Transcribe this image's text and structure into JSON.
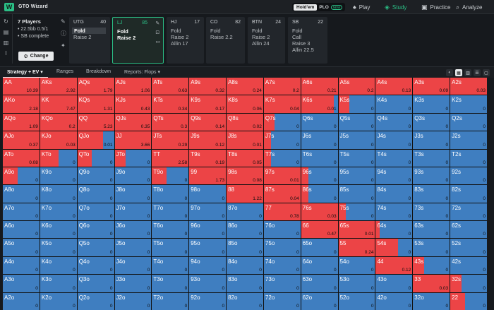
{
  "app": {
    "logo_letter": "W",
    "brand": "GTO Wizard"
  },
  "game_toggle": {
    "holdem": "Hold'em",
    "plo": "PLO",
    "plo_badge": "NEW"
  },
  "nav": [
    {
      "label": "Play",
      "icon": "spade"
    },
    {
      "label": "Study",
      "icon": "layers",
      "active": true
    },
    {
      "label": "Practice",
      "icon": "gamepad"
    },
    {
      "label": "Analyze",
      "icon": "search"
    }
  ],
  "info": {
    "players": "7 Players",
    "stack": "• 22.5bb 0.5/1",
    "status": "• SB complete",
    "change_label": "Change"
  },
  "positions": [
    {
      "name": "UTG",
      "stack": "40",
      "actions": [
        "Fold",
        "Raise 2"
      ],
      "selected": 0
    },
    {
      "name": "LJ",
      "stack": "85",
      "actions": [
        "Fold",
        "Raise 2"
      ],
      "selected": 1,
      "active": true
    },
    {
      "name": "HJ",
      "stack": "17",
      "actions": [
        "Fold",
        "Raise 2",
        "Allin 17"
      ]
    },
    {
      "name": "CO",
      "stack": "82",
      "actions": [
        "Fold",
        "Raise 2.2"
      ]
    },
    {
      "name": "BTN",
      "stack": "24",
      "actions": [
        "Fold",
        "Raise 2",
        "Allin 24"
      ]
    },
    {
      "name": "SB",
      "stack": "22",
      "actions": [
        "Fold",
        "Call",
        "Raise 3",
        "Allin 22.5"
      ]
    }
  ],
  "tabs": {
    "strategy": "Strategy + EV",
    "ranges": "Ranges",
    "breakdown": "Breakdown",
    "reports": "Reports: Flops"
  },
  "colors": {
    "raise": "#ec4446",
    "fold": "#3f7ec0",
    "accent": "#2bbf86"
  },
  "grid": {
    "ranks": [
      "A",
      "K",
      "Q",
      "J",
      "T",
      "9",
      "8",
      "7",
      "6",
      "5",
      "4",
      "3",
      "2"
    ],
    "raise_freq": [
      [
        1,
        1,
        1,
        1,
        1,
        1,
        1,
        1,
        1,
        1,
        1,
        1,
        1
      ],
      [
        1,
        1,
        1,
        1,
        1,
        1,
        1,
        1,
        0.9,
        0.3,
        0,
        0,
        0
      ],
      [
        1,
        1,
        1,
        1,
        1,
        1,
        1,
        0.3,
        0,
        0,
        0,
        0,
        0
      ],
      [
        1,
        1,
        0.7,
        1,
        1,
        1,
        1,
        0.2,
        0,
        0,
        0,
        0,
        0
      ],
      [
        1,
        0.5,
        0.4,
        0.3,
        1,
        1,
        1,
        0.2,
        0,
        0,
        0,
        0,
        0
      ],
      [
        0.4,
        0,
        0,
        0,
        0.4,
        1,
        1,
        1,
        0.2,
        0,
        0,
        0,
        0
      ],
      [
        0,
        0,
        0,
        0,
        0,
        0,
        1,
        1,
        0.2,
        0,
        0,
        0,
        0
      ],
      [
        0,
        0,
        0,
        0,
        0,
        0,
        0,
        1,
        1,
        0.2,
        0,
        0,
        0
      ],
      [
        0,
        0,
        0,
        0,
        0,
        0,
        0,
        0,
        1,
        1,
        0.1,
        0,
        0
      ],
      [
        0,
        0,
        0,
        0,
        0,
        0,
        0,
        0,
        0,
        1,
        0.6,
        0,
        0
      ],
      [
        0,
        0,
        0,
        0,
        0,
        0,
        0,
        0,
        0,
        0,
        1,
        0.3,
        0
      ],
      [
        0,
        0,
        0,
        0,
        0,
        0,
        0,
        0,
        0,
        0,
        0,
        1,
        0.3
      ],
      [
        0,
        0,
        0,
        0,
        0,
        0,
        0,
        0,
        0,
        0,
        0,
        0,
        0.4
      ]
    ],
    "ev": [
      [
        "10.39",
        "2.92",
        "1.79",
        "1.06",
        "0.63",
        "0.32",
        "0.24",
        "0.2",
        "0.21",
        "0.2",
        "0.13",
        "0.09",
        "0.03"
      ],
      [
        "2.18",
        "7.47",
        "1.31",
        "0.43",
        "0.34",
        "0.17",
        "0.06",
        "0.04",
        "0.01",
        "0",
        "0",
        "0",
        "0"
      ],
      [
        "1.09",
        "0.2",
        "5.23",
        "0.35",
        "0.3",
        "0.14",
        "0.02",
        "0",
        "0",
        "0",
        "0",
        "0",
        "0"
      ],
      [
        "0.37",
        "0.03",
        "0.01",
        "3.66",
        "0.29",
        "0.12",
        "0.01",
        "0",
        "0",
        "0",
        "0",
        "0",
        "0"
      ],
      [
        "0.08",
        "0",
        "0",
        "0",
        "2.58",
        "0.19",
        "0.05",
        "0",
        "0",
        "0",
        "0",
        "0",
        "0"
      ],
      [
        "0",
        "0",
        "0",
        "0",
        "0",
        "1.73",
        "0.08",
        "0.01",
        "0",
        "0",
        "0",
        "0",
        "0"
      ],
      [
        "0",
        "0",
        "0",
        "0",
        "0",
        "0",
        "1.22",
        "0.04",
        "0",
        "0",
        "0",
        "0",
        "0"
      ],
      [
        "0",
        "0",
        "0",
        "0",
        "0",
        "0",
        "0",
        "0.78",
        "0.03",
        "0",
        "0",
        "0",
        "0"
      ],
      [
        "0",
        "0",
        "0",
        "0",
        "0",
        "0",
        "0",
        "0",
        "0.47",
        "0.01",
        "0",
        "0",
        "0"
      ],
      [
        "0",
        "0",
        "0",
        "0",
        "0",
        "0",
        "0",
        "0",
        "0",
        "0.24",
        "0",
        "0",
        "0"
      ],
      [
        "0",
        "0",
        "0",
        "0",
        "0",
        "0",
        "0",
        "0",
        "0",
        "0",
        "0.12",
        "0",
        "0"
      ],
      [
        "0",
        "0",
        "0",
        "0",
        "0",
        "0",
        "0",
        "0",
        "0",
        "0",
        "0",
        "0.03",
        "0"
      ],
      [
        "0",
        "0",
        "0",
        "0",
        "0",
        "0",
        "0",
        "0",
        "0",
        "0",
        "0",
        "0",
        "0"
      ]
    ]
  }
}
